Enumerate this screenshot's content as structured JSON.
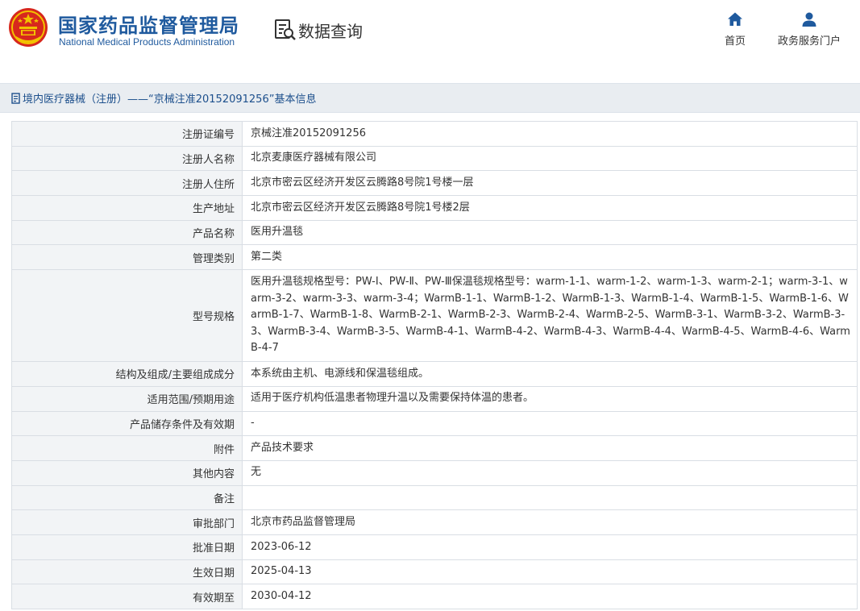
{
  "header": {
    "brand_cn": "国家药品监督管理局",
    "brand_en": "National Medical Products Administration",
    "query_title": "数据查询",
    "nav": [
      {
        "label": "首页",
        "icon": "home-icon"
      },
      {
        "label": "政务服务门户",
        "icon": "user-icon"
      }
    ]
  },
  "colors": {
    "brand_blue": "#1f5a9e",
    "title_bar_bg": "#e9edf1",
    "label_cell_bg": "#f2f4f6",
    "border": "#d9dee4"
  },
  "title_bar": {
    "text": "境内医疗器械（注册）——“京械注准20152091256”基本信息"
  },
  "details": {
    "rows": [
      {
        "label": "注册证编号",
        "value": "京械注准20152091256"
      },
      {
        "label": "注册人名称",
        "value": "北京麦康医疗器械有限公司"
      },
      {
        "label": "注册人住所",
        "value": "北京市密云区经济开发区云腾路8号院1号楼一层"
      },
      {
        "label": "生产地址",
        "value": "北京市密云区经济开发区云腾路8号院1号楼2层"
      },
      {
        "label": "产品名称",
        "value": "医用升温毯"
      },
      {
        "label": "管理类别",
        "value": "第二类"
      },
      {
        "label": "型号规格",
        "value": "医用升温毯规格型号：PW-Ⅰ、PW-Ⅱ、PW-Ⅲ保温毯规格型号：warm-1-1、warm-1-2、warm-1-3、warm-2-1；warm-3-1、warm-3-2、warm-3-3、warm-3-4；WarmB-1-1、WarmB-1-2、WarmB-1-3、WarmB-1-4、WarmB-1-5、WarmB-1-6、WarmB-1-7、WarmB-1-8、WarmB-2-1、WarmB-2-3、WarmB-2-4、WarmB-2-5、WarmB-3-1、WarmB-3-2、WarmB-3-3、WarmB-3-4、WarmB-3-5、WarmB-4-1、WarmB-4-2、WarmB-4-3、WarmB-4-4、WarmB-4-5、WarmB-4-6、WarmB-4-7"
      },
      {
        "label": "结构及组成/主要组成成分",
        "value": "本系统由主机、电源线和保温毯组成。"
      },
      {
        "label": "适用范围/预期用途",
        "value": "适用于医疗机构低温患者物理升温以及需要保持体温的患者。"
      },
      {
        "label": "产品储存条件及有效期",
        "value": "-"
      },
      {
        "label": "附件",
        "value": "产品技术要求"
      },
      {
        "label": "其他内容",
        "value": "无"
      },
      {
        "label": "备注",
        "value": ""
      },
      {
        "label": "审批部门",
        "value": "北京市药品监督管理局"
      },
      {
        "label": "批准日期",
        "value": "2023-06-12"
      },
      {
        "label": "生效日期",
        "value": "2025-04-13"
      },
      {
        "label": "有效期至",
        "value": "2030-04-12"
      }
    ]
  }
}
